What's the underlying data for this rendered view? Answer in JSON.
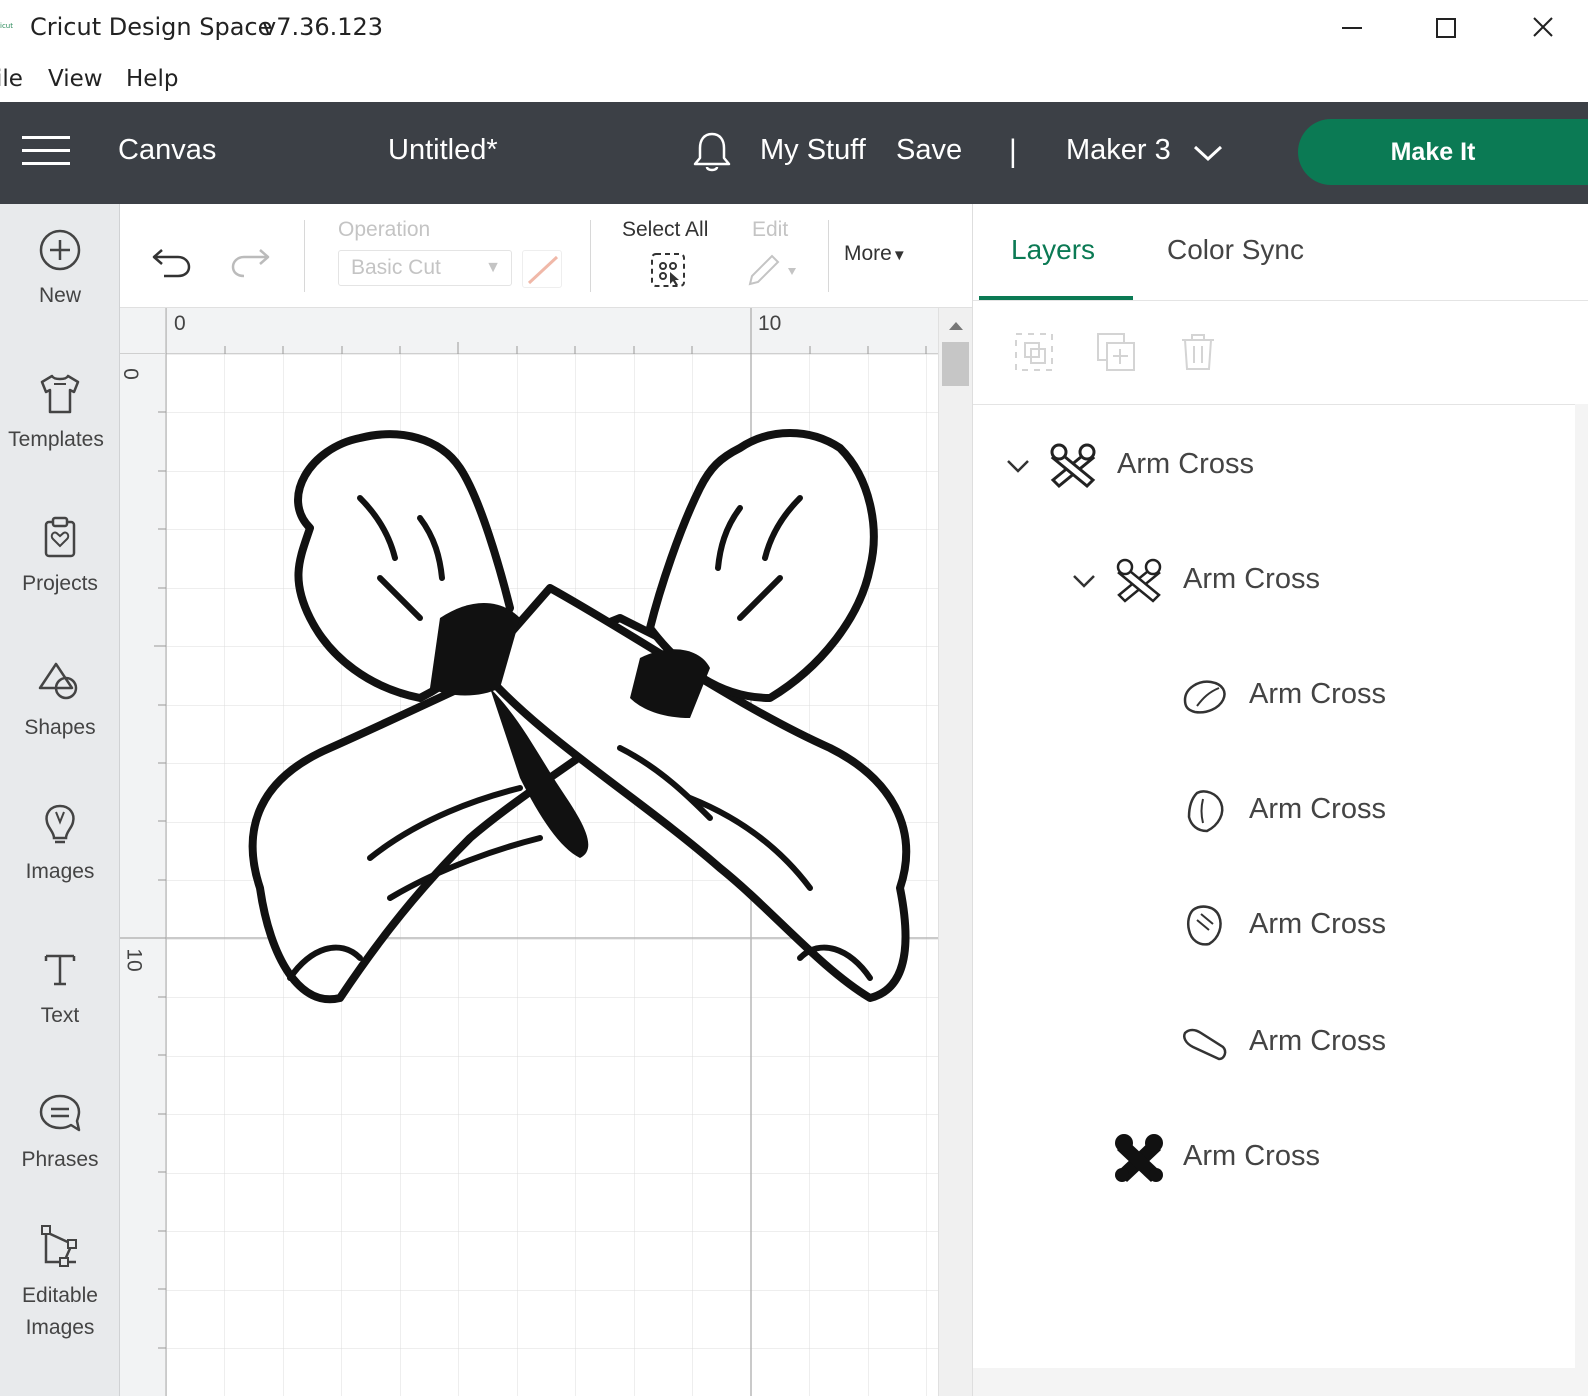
{
  "window": {
    "logo_text": "icut",
    "title": "Cricut Design Space",
    "version": "v7.36.123"
  },
  "menu": {
    "file": "ile",
    "view": "View",
    "help": "Help"
  },
  "header": {
    "canvas": "Canvas",
    "project_name": "Untitled*",
    "my_stuff": "My Stuff",
    "save": "Save",
    "separator": "|",
    "machine": "Maker 3",
    "make_it": "Make It",
    "accent_color": "#0b7a54",
    "background_color": "#3c4046"
  },
  "sidebar": {
    "items": [
      {
        "label": "New",
        "icon": "plus-circle-icon"
      },
      {
        "label": "Templates",
        "icon": "tshirt-icon"
      },
      {
        "label": "Projects",
        "icon": "clipboard-heart-icon"
      },
      {
        "label": "Shapes",
        "icon": "shapes-icon"
      },
      {
        "label": "Images",
        "icon": "lightbulb-icon"
      },
      {
        "label": "Text",
        "icon": "text-t-icon"
      },
      {
        "label": "Phrases",
        "icon": "speech-bubble-icon"
      },
      {
        "label": "Editable",
        "label2": "Images",
        "icon": "editable-image-icon"
      }
    ]
  },
  "toolbar": {
    "operation_label": "Operation",
    "operation_value": "Basic Cut",
    "select_all": "Select All",
    "edit": "Edit",
    "more": "More"
  },
  "canvas": {
    "ruler_top": [
      "0",
      "10"
    ],
    "ruler_left": [
      "0",
      "10"
    ],
    "artwork": "crossed-arms-image"
  },
  "panel": {
    "tabs": [
      "Layers",
      "Color Sync"
    ],
    "active_tab": "Layers",
    "layers": [
      {
        "name": "Arm Cross",
        "level": 0,
        "expanded": true,
        "thumb": "arm-cross-group-icon"
      },
      {
        "name": "Arm Cross",
        "level": 1,
        "expanded": true,
        "thumb": "arm-cross-group-icon"
      },
      {
        "name": "Arm Cross",
        "level": 2,
        "thumb": "left-fist-icon"
      },
      {
        "name": "Arm Cross",
        "level": 2,
        "thumb": "right-fist-icon"
      },
      {
        "name": "Arm Cross",
        "level": 2,
        "thumb": "fist-detail-icon"
      },
      {
        "name": "Arm Cross",
        "level": 2,
        "thumb": "forearm-icon"
      },
      {
        "name": "Arm Cross",
        "level": 1,
        "thumb": "x-silhouette-icon"
      }
    ]
  }
}
